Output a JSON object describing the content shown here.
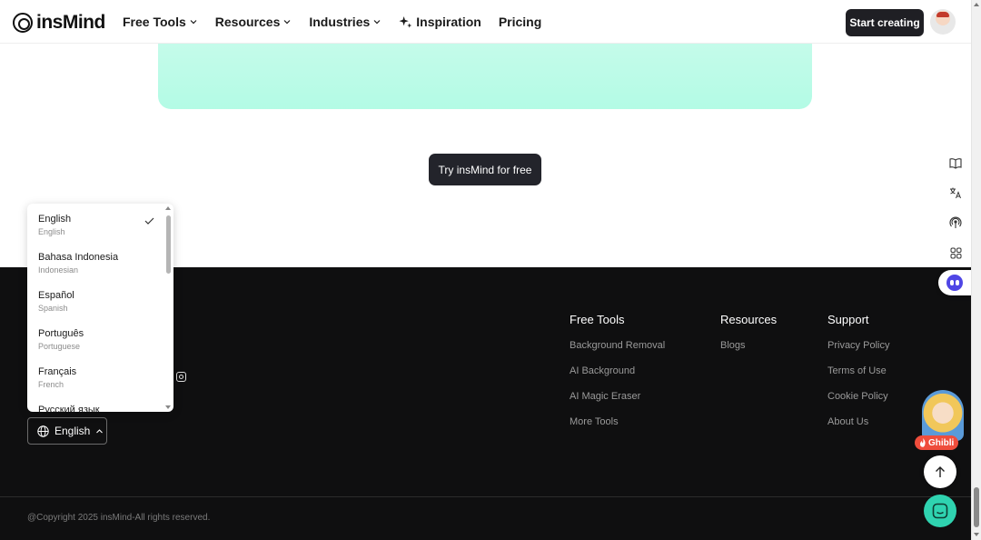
{
  "header": {
    "logo_text": "insMind",
    "nav": [
      {
        "label": "Free Tools",
        "has_dropdown": true
      },
      {
        "label": "Resources",
        "has_dropdown": true
      },
      {
        "label": "Industries",
        "has_dropdown": true
      },
      {
        "label": "Inspiration",
        "has_dropdown": false,
        "icon": "sparkle-icon"
      },
      {
        "label": "Pricing",
        "has_dropdown": false
      }
    ],
    "cta_label": "Start creating"
  },
  "hero": {
    "try_label": "Try insMind for free"
  },
  "language_menu": {
    "items": [
      {
        "name": "English",
        "sub": "English",
        "selected": true
      },
      {
        "name": "Bahasa Indonesia",
        "sub": "Indonesian",
        "selected": false
      },
      {
        "name": "Español",
        "sub": "Spanish",
        "selected": false
      },
      {
        "name": "Português",
        "sub": "Portuguese",
        "selected": false
      },
      {
        "name": "Français",
        "sub": "French",
        "selected": false
      },
      {
        "name": "Русский язык",
        "sub": "",
        "selected": false
      }
    ],
    "current": "English"
  },
  "footer": {
    "columns": [
      {
        "title": "Free Tools",
        "links": [
          "Background Removal",
          "AI Background",
          "AI Magic Eraser",
          "More Tools"
        ]
      },
      {
        "title": "Resources",
        "links": [
          "Blogs"
        ]
      },
      {
        "title": "Support",
        "links": [
          "Privacy Policy",
          "Terms of Use",
          "Cookie Policy",
          "About Us"
        ]
      }
    ],
    "copyright": "@Copyright 2025 insMind-All rights reserved."
  },
  "floating": {
    "ghibli_label": "Ghibli"
  },
  "colors": {
    "mint": "#b3fbe5",
    "footer_bg": "#0f0f10",
    "dark_button": "#1f1f24",
    "chat_accent": "#2fd3b0",
    "ghibli_tag": "#ef4d3c"
  }
}
